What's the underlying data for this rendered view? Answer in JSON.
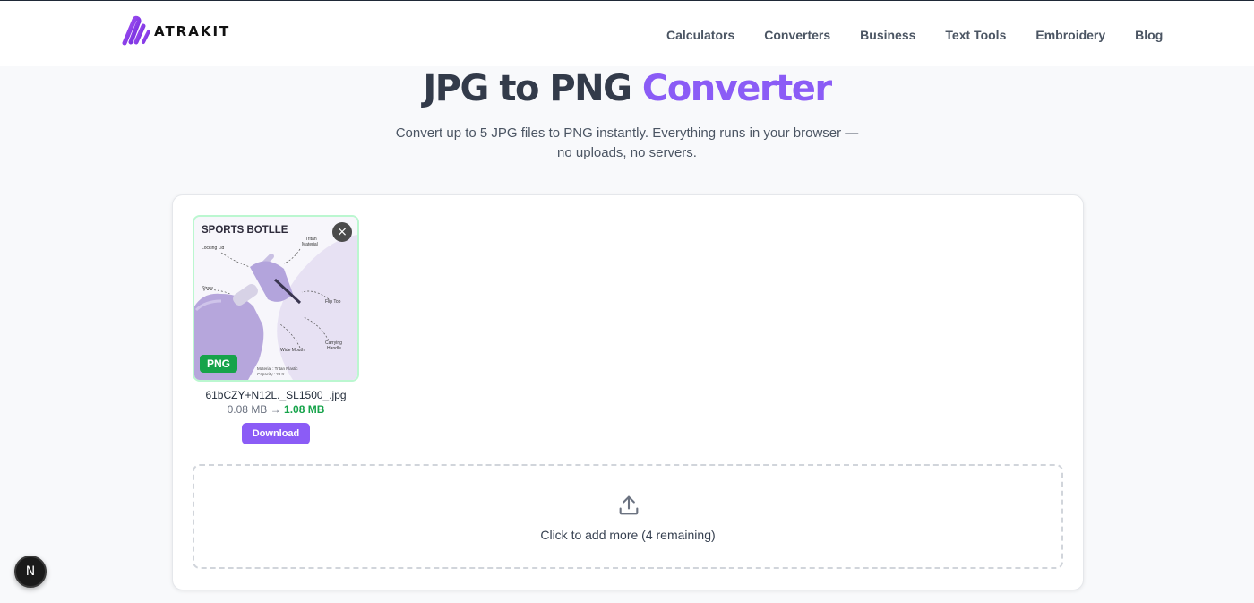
{
  "header": {
    "logo_text": "ATRAKIT",
    "nav": [
      "Calculators",
      "Converters",
      "Business",
      "Text Tools",
      "Embroidery",
      "Blog"
    ]
  },
  "hero": {
    "title_main": "JPG to PNG",
    "title_accent": "Converter",
    "subtitle_line1": "Convert up to 5 JPG files to PNG instantly. Everything runs in your browser —",
    "subtitle_line2": "no uploads, no servers."
  },
  "files": [
    {
      "thumbnail_title": "SPORTS BOTLLE",
      "thumbnail_labels": {
        "locking_lid": "Locking Lid",
        "tritan_line1": "Tritan",
        "tritan_line2": "Material",
        "straw": "Straw",
        "flip_top": "Flip Top",
        "wide_mouth": "Wide Mouth",
        "carrying_line1": "Carrying",
        "carrying_line2": "Handle",
        "material": "Material : Tritan Plastic",
        "capacity": "Capacity : 2 Ltr."
      },
      "format_badge": "PNG",
      "remove_icon": "×",
      "name": "61bCZY+N12L._SL1500_.jpg",
      "size_original": "0.08 MB",
      "size_arrow": "→",
      "size_converted": "1.08 MB",
      "download_label": "Download"
    }
  ],
  "dropzone": {
    "icon": "upload-icon",
    "text": "Click to add more (4 remaining)"
  },
  "dev_badge": "N",
  "colors": {
    "accent": "#8b5cf6",
    "success": "#16a34a",
    "heading": "#333b4a"
  }
}
